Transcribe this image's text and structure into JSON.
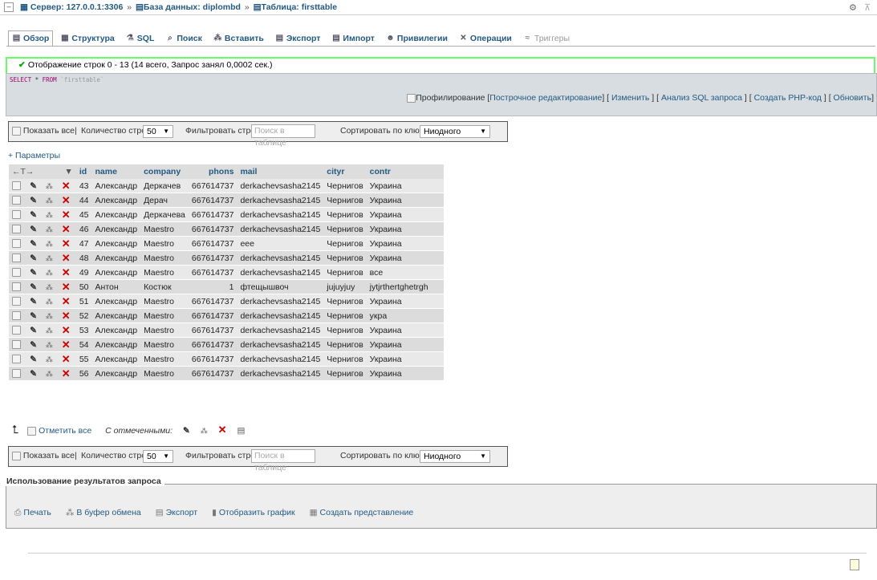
{
  "breadcrumb": {
    "server": "Сервер: 127.0.0.1:3306",
    "database": "База данных: diplombd",
    "table": "Таблица: firsttable",
    "sep": "»"
  },
  "tabs": [
    {
      "label": "Обзор",
      "icon": "browse-icon",
      "active": true
    },
    {
      "label": "Структура",
      "icon": "structure-icon"
    },
    {
      "label": "SQL",
      "icon": "sql-icon"
    },
    {
      "label": "Поиск",
      "icon": "search-icon"
    },
    {
      "label": "Вставить",
      "icon": "insert-icon"
    },
    {
      "label": "Экспорт",
      "icon": "export-icon"
    },
    {
      "label": "Импорт",
      "icon": "import-icon"
    },
    {
      "label": "Привилегии",
      "icon": "privileges-icon"
    },
    {
      "label": "Операции",
      "icon": "operations-icon"
    },
    {
      "label": "Триггеры",
      "icon": "triggers-icon",
      "disabled": true
    }
  ],
  "success": {
    "message": "Отображение строк 0 - 13 (14 всего, Запрос занял 0,0002 сек.)"
  },
  "sql": {
    "select": "SELECT",
    "star": "*",
    "from": "FROM",
    "table": "`firsttable`"
  },
  "sql_links": {
    "profiling": "Профилирование",
    "inline_edit": "Построчное редактирование",
    "edit": "Изменить",
    "analyze": "Анализ SQL запроса",
    "php": "Создать PHP-код",
    "refresh": "Обновить"
  },
  "nav": {
    "show_all": "Показать все",
    "divider": "|",
    "rows_label": "Количество строк:",
    "rows_value": "50",
    "filter_label": "Фильтровать строки:",
    "filter_placeholder": "Поиск в таблице",
    "sort_label": "Сортировать по ключу:",
    "sort_value": "Ниодного"
  },
  "params_label": "+ Параметры",
  "table": {
    "arrows": "←T→",
    "sort_glyph": "▼",
    "columns": [
      "id",
      "name",
      "company",
      "phons",
      "mail",
      "cityr",
      "contr"
    ],
    "rows": [
      [
        "43",
        "Александр",
        "Деркачев",
        "667614737",
        "derkachevsasha2145",
        "Чернигов",
        "Украина"
      ],
      [
        "44",
        "Александр",
        "Дерач",
        "667614737",
        "derkachevsasha2145",
        "Чернигов",
        "Украина"
      ],
      [
        "45",
        "Александр",
        "Деркачева",
        "667614737",
        "derkachevsasha2145",
        "Чернигов",
        "Украина"
      ],
      [
        "46",
        "Александр",
        "Maestro",
        "667614737",
        "derkachevsasha2145",
        "Чернигов",
        "Украина"
      ],
      [
        "47",
        "Александр",
        "Maestro",
        "667614737",
        "eee",
        "Чернигов",
        "Украина"
      ],
      [
        "48",
        "Александр",
        "Maestro",
        "667614737",
        "derkachevsasha2145",
        "Чернигов",
        "Украина"
      ],
      [
        "49",
        "Александр",
        "Maestro",
        "667614737",
        "derkachevsasha2145",
        "Чернигов",
        "все"
      ],
      [
        "50",
        "Антон",
        "Костюк",
        "1",
        "фтещышвоч",
        "jujuyjuy",
        "jytjrthertghetrgh"
      ],
      [
        "51",
        "Александр",
        "Maestro",
        "667614737",
        "derkachevsasha2145",
        "Чернигов",
        "Украина"
      ],
      [
        "52",
        "Александр",
        "Maestro",
        "667614737",
        "derkachevsasha2145",
        "Чернигов",
        "укра"
      ],
      [
        "53",
        "Александр",
        "Maestro",
        "667614737",
        "derkachevsasha2145",
        "Чернигов",
        "Украина"
      ],
      [
        "54",
        "Александр",
        "Maestro",
        "667614737",
        "derkachevsasha2145",
        "Чернигов",
        "Украина"
      ],
      [
        "55",
        "Александр",
        "Maestro",
        "667614737",
        "derkachevsasha2145",
        "Чернигов",
        "Украина"
      ],
      [
        "56",
        "Александр",
        "Maestro",
        "667614737",
        "derkachevsasha2145",
        "Чернигов",
        "Украина"
      ]
    ]
  },
  "with_selected": {
    "check_all": "Отметить все",
    "label": "С отмеченными:"
  },
  "query_results": {
    "legend": "Использование результатов запроса",
    "print": "Печать",
    "clipboard": "В буфер обмена",
    "export": "Экспорт",
    "chart": "Отобразить график",
    "view": "Создать представление"
  }
}
